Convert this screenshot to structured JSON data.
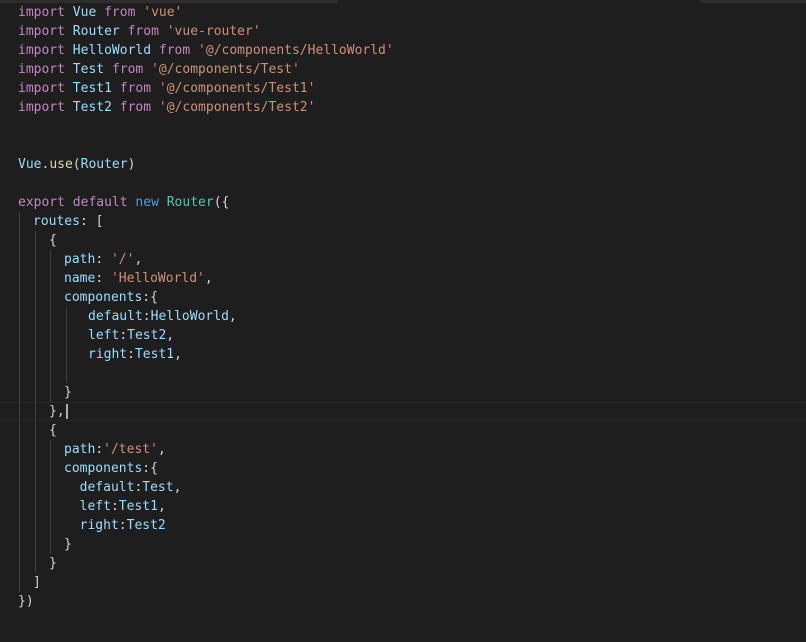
{
  "editor": {
    "language": "javascript",
    "theme_colors": {
      "background": "#1e1e1e",
      "keyword": "#c586c0",
      "storage": "#569cd6",
      "string": "#ce9178",
      "identifier": "#9cdcfe",
      "class": "#4ec9b0",
      "function": "#dcdcaa",
      "punctuation": "#d4d4d4"
    },
    "lines": [
      {
        "indent": 0,
        "tokens": [
          [
            "kw",
            "import"
          ],
          [
            "pun",
            " "
          ],
          [
            "id",
            "Vue"
          ],
          [
            "pun",
            " "
          ],
          [
            "kw",
            "from"
          ],
          [
            "pun",
            " "
          ],
          [
            "str",
            "'vue'"
          ]
        ]
      },
      {
        "indent": 0,
        "tokens": [
          [
            "kw",
            "import"
          ],
          [
            "pun",
            " "
          ],
          [
            "id",
            "Router"
          ],
          [
            "pun",
            " "
          ],
          [
            "kw",
            "from"
          ],
          [
            "pun",
            " "
          ],
          [
            "str",
            "'vue-router'"
          ]
        ]
      },
      {
        "indent": 0,
        "tokens": [
          [
            "kw",
            "import"
          ],
          [
            "pun",
            " "
          ],
          [
            "id",
            "HelloWorld"
          ],
          [
            "pun",
            " "
          ],
          [
            "kw",
            "from"
          ],
          [
            "pun",
            " "
          ],
          [
            "str",
            "'@/components/HelloWorld'"
          ]
        ]
      },
      {
        "indent": 0,
        "tokens": [
          [
            "kw",
            "import"
          ],
          [
            "pun",
            " "
          ],
          [
            "id",
            "Test"
          ],
          [
            "pun",
            " "
          ],
          [
            "kw",
            "from"
          ],
          [
            "pun",
            " "
          ],
          [
            "str",
            "'@/components/Test'"
          ]
        ]
      },
      {
        "indent": 0,
        "tokens": [
          [
            "kw",
            "import"
          ],
          [
            "pun",
            " "
          ],
          [
            "id",
            "Test1"
          ],
          [
            "pun",
            " "
          ],
          [
            "kw",
            "from"
          ],
          [
            "pun",
            " "
          ],
          [
            "str",
            "'@/components/Test1'"
          ]
        ]
      },
      {
        "indent": 0,
        "tokens": [
          [
            "kw",
            "import"
          ],
          [
            "pun",
            " "
          ],
          [
            "id",
            "Test2"
          ],
          [
            "pun",
            " "
          ],
          [
            "kw",
            "from"
          ],
          [
            "pun",
            " "
          ],
          [
            "str",
            "'@/components/Test2'"
          ]
        ]
      },
      {
        "indent": 0,
        "tokens": []
      },
      {
        "indent": 0,
        "tokens": []
      },
      {
        "indent": 0,
        "tokens": [
          [
            "id",
            "Vue"
          ],
          [
            "pun",
            "."
          ],
          [
            "fn",
            "use"
          ],
          [
            "pun",
            "("
          ],
          [
            "id",
            "Router"
          ],
          [
            "pun",
            ")"
          ]
        ]
      },
      {
        "indent": 0,
        "tokens": []
      },
      {
        "indent": 0,
        "tokens": [
          [
            "kw",
            "export"
          ],
          [
            "pun",
            " "
          ],
          [
            "kw",
            "default"
          ],
          [
            "pun",
            " "
          ],
          [
            "kw2",
            "new"
          ],
          [
            "pun",
            " "
          ],
          [
            "cls",
            "Router"
          ],
          [
            "pun",
            "({"
          ]
        ]
      },
      {
        "indent": 1,
        "tokens": [
          [
            "id",
            "routes"
          ],
          [
            "pun",
            ": ["
          ]
        ]
      },
      {
        "indent": 2,
        "tokens": [
          [
            "pun",
            "{"
          ]
        ]
      },
      {
        "indent": 3,
        "tokens": [
          [
            "id",
            "path"
          ],
          [
            "pun",
            ": "
          ],
          [
            "str",
            "'/'"
          ],
          [
            "pun",
            ","
          ]
        ]
      },
      {
        "indent": 3,
        "tokens": [
          [
            "id",
            "name"
          ],
          [
            "pun",
            ": "
          ],
          [
            "str",
            "'HelloWorld'"
          ],
          [
            "pun",
            ","
          ]
        ]
      },
      {
        "indent": 3,
        "tokens": [
          [
            "id",
            "components"
          ],
          [
            "pun",
            ":{"
          ]
        ]
      },
      {
        "indent": 4,
        "tokens": [
          [
            "id",
            "default"
          ],
          [
            "pun",
            ":"
          ],
          [
            "id",
            "HelloWorld"
          ],
          [
            "pun",
            ","
          ]
        ]
      },
      {
        "indent": 4,
        "tokens": [
          [
            "id",
            "left"
          ],
          [
            "pun",
            ":"
          ],
          [
            "id",
            "Test2"
          ],
          [
            "pun",
            ","
          ]
        ]
      },
      {
        "indent": 4,
        "tokens": [
          [
            "id",
            "right"
          ],
          [
            "pun",
            ":"
          ],
          [
            "id",
            "Test1"
          ],
          [
            "pun",
            ","
          ]
        ]
      },
      {
        "indent": 4,
        "tokens": []
      },
      {
        "indent": 3,
        "tokens": [
          [
            "pun",
            "}"
          ]
        ]
      },
      {
        "indent": 2,
        "tokens": [
          [
            "pun",
            "},"
          ]
        ],
        "current": true
      },
      {
        "indent": 2,
        "tokens": [
          [
            "pun",
            "{"
          ]
        ]
      },
      {
        "indent": 3,
        "tokens": [
          [
            "id",
            "path"
          ],
          [
            "pun",
            ":"
          ],
          [
            "str",
            "'/test'"
          ],
          [
            "pun",
            ","
          ]
        ]
      },
      {
        "indent": 3,
        "tokens": [
          [
            "id",
            "components"
          ],
          [
            "pun",
            ":{"
          ]
        ]
      },
      {
        "indent": 3,
        "tokens": [
          [
            "pun",
            "  "
          ],
          [
            "id",
            "default"
          ],
          [
            "pun",
            ":"
          ],
          [
            "id",
            "Test"
          ],
          [
            "pun",
            ","
          ]
        ]
      },
      {
        "indent": 3,
        "tokens": [
          [
            "pun",
            "  "
          ],
          [
            "id",
            "left"
          ],
          [
            "pun",
            ":"
          ],
          [
            "id",
            "Test1"
          ],
          [
            "pun",
            ","
          ]
        ]
      },
      {
        "indent": 3,
        "tokens": [
          [
            "pun",
            "  "
          ],
          [
            "id",
            "right"
          ],
          [
            "pun",
            ":"
          ],
          [
            "id",
            "Test2"
          ]
        ]
      },
      {
        "indent": 3,
        "tokens": [
          [
            "pun",
            "}"
          ]
        ]
      },
      {
        "indent": 2,
        "tokens": [
          [
            "pun",
            "}"
          ]
        ]
      },
      {
        "indent": 1,
        "tokens": [
          [
            "pun",
            "]"
          ]
        ]
      },
      {
        "indent": 0,
        "tokens": [
          [
            "pun",
            "})"
          ]
        ]
      }
    ]
  }
}
